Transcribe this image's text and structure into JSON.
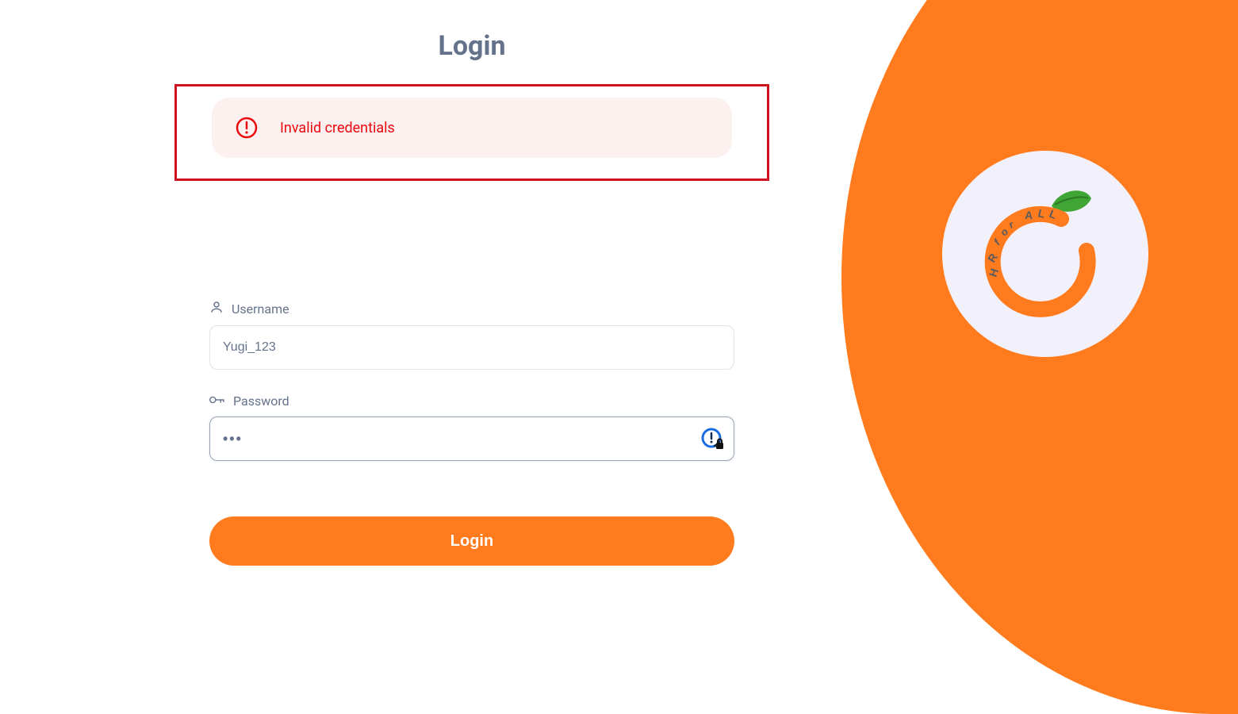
{
  "page": {
    "title": "Login"
  },
  "alert": {
    "message": "Invalid credentials"
  },
  "form": {
    "username_label": "Username",
    "username_value": "Yugi_123",
    "password_label": "Password",
    "password_value": "•••",
    "login_button": "Login"
  },
  "branding": {
    "tagline": "HR for ALL",
    "accent_color": "#ff7b1d"
  }
}
